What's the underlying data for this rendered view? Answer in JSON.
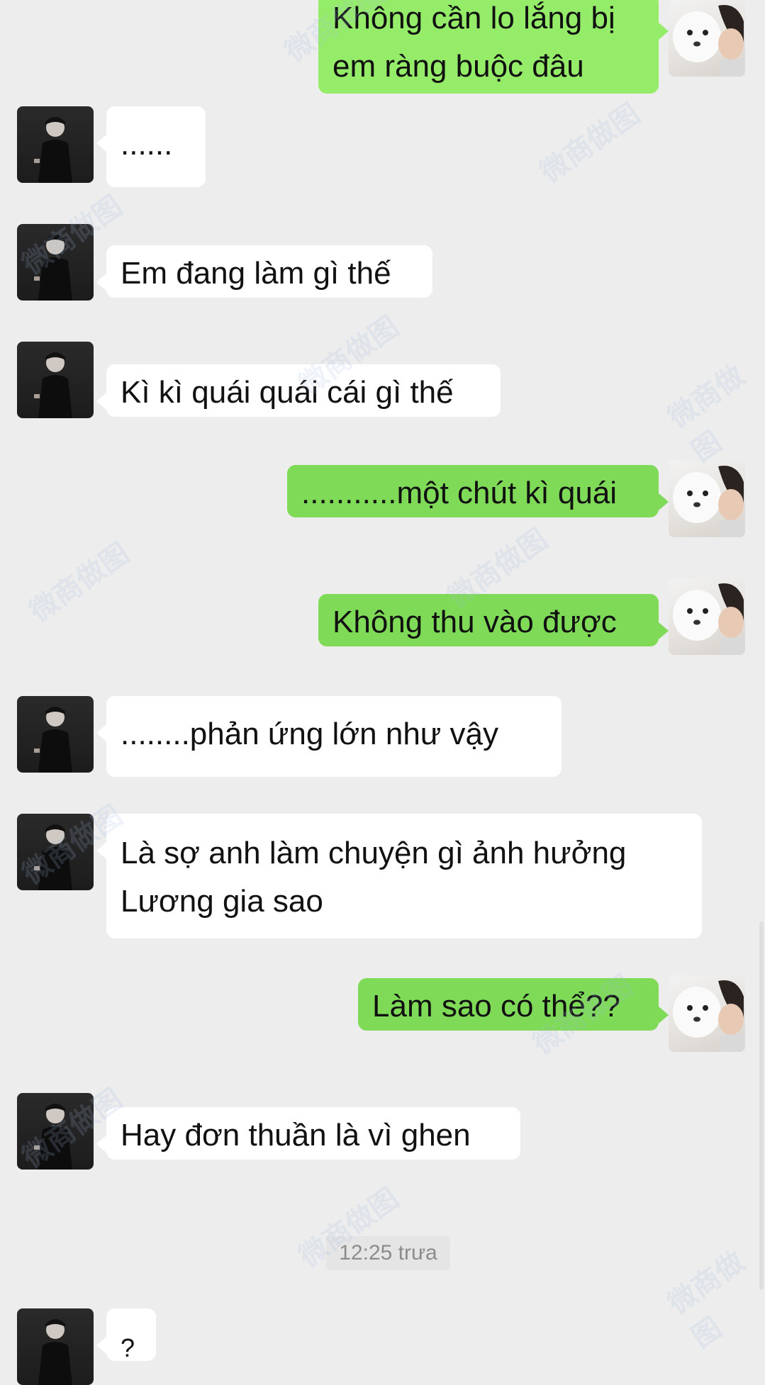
{
  "messages": [
    {
      "side": "out",
      "text": "Không cần lo lắng bị\nem ràng buộc đâu"
    },
    {
      "side": "in",
      "text": "......"
    },
    {
      "side": "in",
      "text": "Em đang làm gì thế"
    },
    {
      "side": "in",
      "text": "Kì kì quái quái cái gì thế"
    },
    {
      "side": "out",
      "text": "...........một chút kì quái"
    },
    {
      "side": "out",
      "text": "Không thu vào được"
    },
    {
      "side": "in",
      "text": "........phản ứng lớn như vậy"
    },
    {
      "side": "in",
      "text": "Là sợ anh làm chuyện gì ảnh hưởng\nLương gia sao"
    },
    {
      "side": "out",
      "text": "Làm sao có thể??"
    },
    {
      "side": "in",
      "text": "Hay đơn thuần là vì ghen"
    },
    {
      "side": "in",
      "text": "?"
    }
  ],
  "timestamp": "12:25 trưa",
  "avatars": {
    "contact": "man-in-black-suit",
    "self": "white-dog-and-person-selfie"
  },
  "watermark_text": "微商做图",
  "colors": {
    "background": "#ededed",
    "incoming_bubble": "#ffffff",
    "outgoing_bubble": "#95ec69"
  }
}
